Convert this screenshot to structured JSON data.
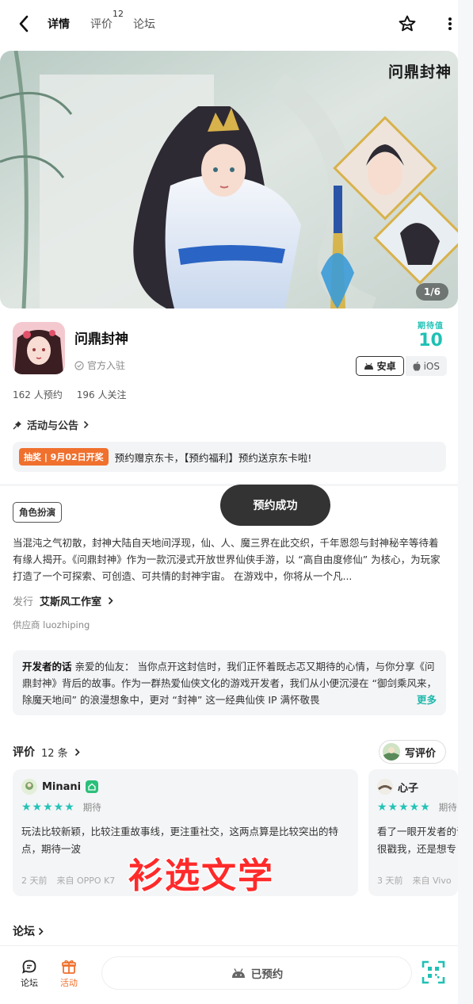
{
  "nav": {
    "tabs": [
      {
        "label": "详情",
        "active": true
      },
      {
        "label": "评价",
        "sup": "12"
      },
      {
        "label": "论坛"
      }
    ]
  },
  "banner": {
    "counter": "1/6",
    "logo_text": "问鼎封神"
  },
  "game": {
    "name": "问鼎封神",
    "official": "官方入驻",
    "expect_label": "期待值",
    "expect_value": "10",
    "platforms": [
      "安卓",
      "iOS"
    ]
  },
  "stats": {
    "reservations": "162 人预约",
    "followers": "196 人关注"
  },
  "activity": {
    "link_label": "活动与公告",
    "promo_tag": "抽奖 | 9月02日开奖",
    "promo_text": "预约赠京东卡，【预约福利】预约送京东卡啦!"
  },
  "toast": "预约成功",
  "role_tag": "角色扮演",
  "description": "当混沌之气初散，封神大陆自天地间浮现，仙、人、魔三界在此交织，千年恩怨与封神秘辛等待着有缘人揭开。《问鼎封神》作为一款沉浸式开放世界仙侠手游，以 “高自由度修仙” 为核心，为玩家打造了一个可探索、可创造、可共情的封神宇宙。 在游戏中，你将从一个凡...",
  "publisher": {
    "label": "发行",
    "value": "艾斯风工作室"
  },
  "supplier": "供应商 luozhiping",
  "dev_note": {
    "title": "开发者的话",
    "text": "亲爱的仙友： 当你点开这封信时，我们正怀着既忐忑又期待的心情，与你分享《问鼎封神》背后的故事。作为一群热爱仙侠文化的游戏开发者，我们从小便沉浸在 “御剑乘风来，除魔天地间” 的浪漫想象中，更对 “封神” 这一经典仙侠 IP 满怀敬畏",
    "more": "更多"
  },
  "reviews": {
    "title": "评价",
    "count": "12 条",
    "write_label": "写评价",
    "items": [
      {
        "user": "Minani",
        "stars": "★★★★★",
        "status": "期待",
        "text": "玩法比较新颖，比较注重故事线，更注重社交，这两点算是比较突出的特点，期待一波",
        "time": "2 天前",
        "device": "来自 OPPO K7"
      },
      {
        "user": "心子",
        "stars": "★★★★★",
        "status": "期待",
        "text": "看了一眼开发者的话，仑，朝歌的还是非常很戳我，还是想专",
        "time": "3 天前",
        "device": "来自 Vivo"
      }
    ]
  },
  "watermark": "衫选文学",
  "forum": {
    "label": "论坛"
  },
  "bottom": {
    "forum": "论坛",
    "activity": "活动",
    "reserved": "已预约"
  },
  "colors": {
    "accent": "#23c3b6",
    "promo": "#f0702d",
    "toast": "#333333"
  },
  "icons": [
    "back-icon",
    "star-outline-icon",
    "more-vertical-icon",
    "pin-icon",
    "verified-icon",
    "android-icon",
    "apple-icon",
    "forum-icon",
    "gift-icon",
    "qr-scan-icon"
  ]
}
